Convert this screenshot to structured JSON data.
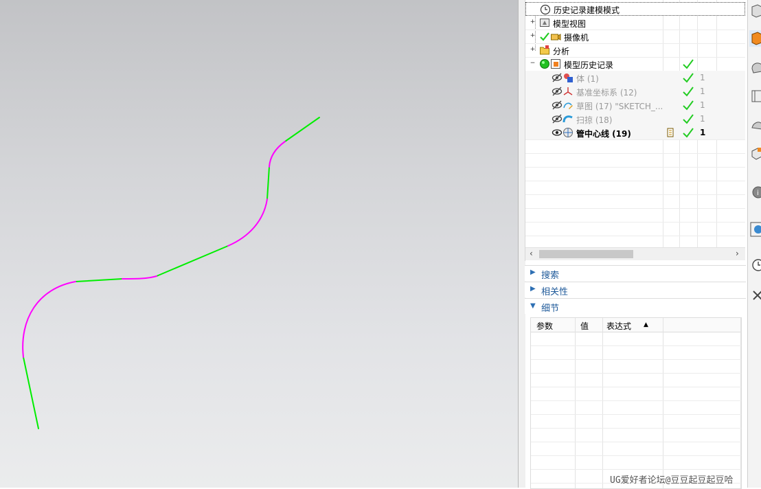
{
  "navigator": {
    "rows": [
      {
        "name": "历史记录建模模式",
        "icon": "clock-icon"
      },
      {
        "name": "模型视图",
        "icon": "model-view-icon"
      },
      {
        "name": "摄像机",
        "icon": "camera-icon"
      },
      {
        "name": "分析",
        "icon": "analysis-icon"
      },
      {
        "name": "模型历史记录",
        "icon": "model-history-icon"
      },
      {
        "name": "体 (1)",
        "icon": "body-icon",
        "number": "1"
      },
      {
        "name": "基准坐标系 (12)",
        "icon": "datum-csys-icon",
        "number": "1"
      },
      {
        "name": "草图 (17) \"SKETCH_...",
        "icon": "sketch-icon",
        "number": "1"
      },
      {
        "name": "扫掠 (18)",
        "icon": "sweep-icon",
        "number": "1"
      },
      {
        "name": "管中心线 (19)",
        "icon": "tube-centerline-icon",
        "number": "1"
      }
    ]
  },
  "panels": {
    "search": "搜索",
    "dependencies": "相关性",
    "details": "细节"
  },
  "details_table": {
    "columns": [
      "参数",
      "值",
      "表达式"
    ]
  },
  "watermark": "UG爱好者论坛@豆豆起豆起豆哈",
  "colors": {
    "curve_magenta": "#ff00ff",
    "curve_green": "#00ee00",
    "check_green": "#22cc22",
    "link_blue": "#1f5a9a"
  }
}
